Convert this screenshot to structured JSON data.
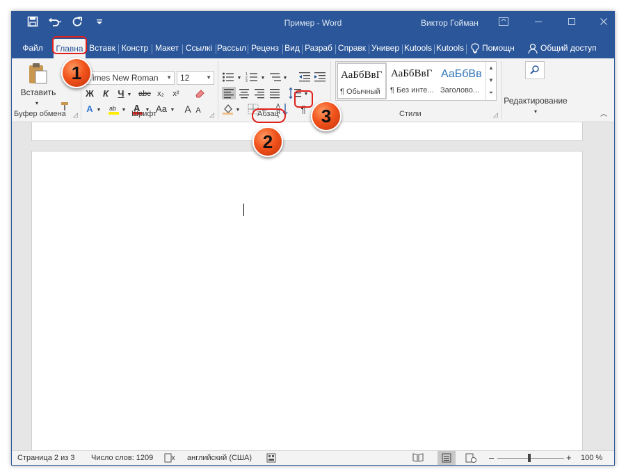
{
  "window": {
    "title": "Пример  -  Word",
    "user": "Виктор Гойман",
    "qat": {
      "save_icon": "save-icon",
      "undo_icon": "undo-icon",
      "redo_icon": "redo-icon",
      "customize_icon": "customize-icon"
    }
  },
  "tabs": [
    {
      "label": "Файл"
    },
    {
      "label": "Главна"
    },
    {
      "label": "Вставк"
    },
    {
      "label": "Констр"
    },
    {
      "label": "Макет"
    },
    {
      "label": "Ссылкі"
    },
    {
      "label": "Рассыл"
    },
    {
      "label": "Реценз"
    },
    {
      "label": "Вид"
    },
    {
      "label": "Разраб"
    },
    {
      "label": "Справк"
    },
    {
      "label": "Универ"
    },
    {
      "label": "Kutools"
    },
    {
      "label": "Kutools"
    },
    {
      "label": "Помощн"
    },
    {
      "label": "Общий доступ"
    }
  ],
  "ribbon": {
    "clipboard": {
      "paste_label": "Вставить",
      "group_label": "Буфер обмена"
    },
    "font": {
      "font_name": "Times New Roman",
      "font_size": "12",
      "group_label": "Шрифт"
    },
    "paragraph": {
      "group_label": "Абзац",
      "pilcrow": "¶"
    },
    "styles": {
      "group_label": "Стили",
      "items": [
        {
          "sample": "АаБбВвГ",
          "name": "¶ Обычный"
        },
        {
          "sample": "АаБбВвГ",
          "name": "¶ Без инте..."
        },
        {
          "sample": "АаБбВв",
          "name": "Заголово..."
        }
      ]
    },
    "editing": {
      "label": "Редактирование"
    }
  },
  "statusbar": {
    "page": "Страница 2 из 3",
    "words": "Число слов: 1209",
    "language": "английский (США)",
    "zoom": "100 %"
  },
  "callouts": [
    "1",
    "2",
    "3"
  ],
  "colors": {
    "accent": "#2b579a",
    "highlight": "#e0201b",
    "badge": "#f2531c"
  }
}
